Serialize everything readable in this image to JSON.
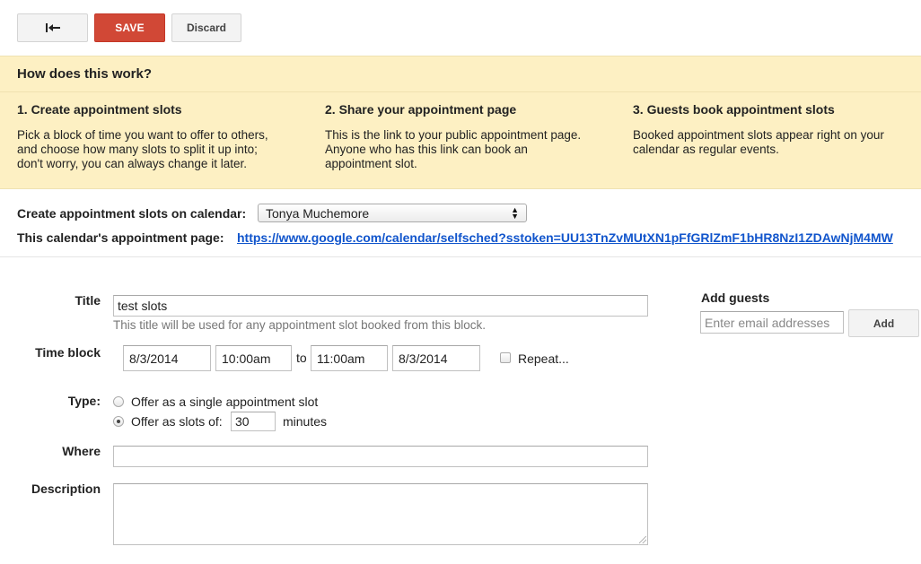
{
  "toolbar": {
    "back_icon": "back-arrow-icon",
    "save_label": "SAVE",
    "discard_label": "Discard"
  },
  "info": {
    "heading": "How does this work?",
    "steps": [
      {
        "title": "1. Create appointment slots",
        "line1": "Pick a block of time you want to offer to others,",
        "line2": "and choose how many slots to split it up into;",
        "line3": "don't worry, you can always change it later."
      },
      {
        "title": "2. Share your appointment page",
        "line1": "This is the link to your public appointment page.",
        "line2": "Anyone who has this link can book an",
        "line3": "appointment slot."
      },
      {
        "title": "3. Guests book appointment slots",
        "line1": "Booked appointment slots appear right on your",
        "line2": "calendar as regular events.",
        "line3": ""
      }
    ]
  },
  "calendar": {
    "label": "Create appointment slots on calendar:",
    "selected": "Tonya Muchemore",
    "page_label": "This calendar's appointment page:",
    "page_url": "https://www.google.com/calendar/selfsched?sstoken=UU13TnZvMUtXN1pFfGRlZmF1bHR8NzI1ZDAwNjM4MW"
  },
  "form": {
    "title_label": "Title",
    "title_value": "test slots",
    "title_hint": "This title will be used for any appointment slot booked from this block.",
    "time_label": "Time block",
    "start_date": "8/3/2014",
    "start_time": "10:00am",
    "to_label": "to",
    "end_time": "11:00am",
    "end_date": "8/3/2014",
    "repeat_label": "Repeat...",
    "type_label": "Type:",
    "type_single": "Offer as a single appointment slot",
    "type_slots": "Offer as slots of:",
    "slot_minutes": "30",
    "minutes_label": "minutes",
    "where_label": "Where",
    "where_value": "",
    "description_label": "Description",
    "description_value": ""
  },
  "guests": {
    "heading": "Add guests",
    "placeholder": "Enter email addresses",
    "add_label": "Add"
  },
  "colors": {
    "save_red": "#d14836",
    "info_bg": "#fdf0c3",
    "link_blue": "#1155cc"
  }
}
